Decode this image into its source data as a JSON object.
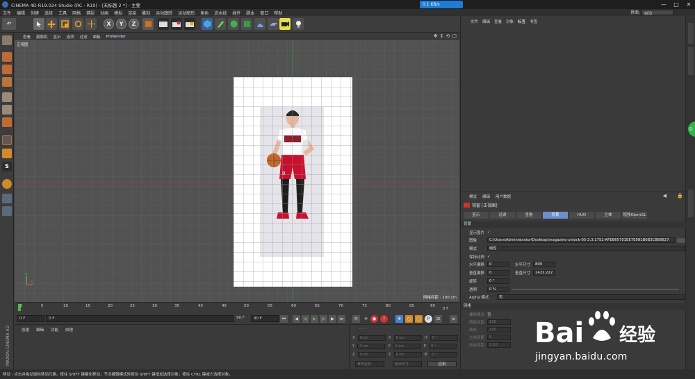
{
  "title_bar": {
    "title": "CINEMA 4D R19.024 Studio (RC - R19) - [未标题 2 *] - 主要",
    "net_badge": "0.1 KB/s",
    "win_min": "—",
    "win_max": "□",
    "win_close": "✕"
  },
  "menu": {
    "items": [
      "文件",
      "编辑",
      "创建",
      "选择",
      "工具",
      "网格",
      "捕捉",
      "动画",
      "模拟",
      "渲染",
      "雕刻",
      "运动跟踪",
      "运动图形",
      "角色",
      "流水线",
      "插件",
      "脚本",
      "窗口",
      "帮助"
    ],
    "layout_label": "界面:",
    "layout_value": "启动"
  },
  "toolbar": {
    "axis_x": "X",
    "axis_y": "Y",
    "axis_z": "Z"
  },
  "viewport_menu": {
    "items": [
      "查看",
      "摄像机",
      "显示",
      "选项",
      "过滤",
      "面板"
    ],
    "prorender": "ProRender"
  },
  "viewport": {
    "label": "正视图",
    "grid_spacing": "网格间距 : 100 cm",
    "axis_y": "Y",
    "axis_x": "X",
    "jersey_number": "9"
  },
  "timeline": {
    "ticks": [
      "0",
      "5",
      "10",
      "15",
      "20",
      "25",
      "30",
      "35",
      "40",
      "45",
      "50",
      "55",
      "60",
      "65",
      "70",
      "75",
      "80",
      "85",
      "90"
    ],
    "end_label": "0 F"
  },
  "transport": {
    "start": "0 F",
    "current": "0 F",
    "end": "90 F",
    "max": "90 F"
  },
  "materials": {
    "tabs": [
      "创建",
      "编辑",
      "功能",
      "纹理"
    ]
  },
  "coords": {
    "header": "- - -",
    "rows": [
      {
        "a": "X",
        "av": "0 cm",
        "b": "X",
        "bv": "0 cm",
        "c": "H",
        "cv": "0 °"
      },
      {
        "a": "Y",
        "av": "0 cm",
        "b": "Y",
        "bv": "0 cm",
        "c": "P",
        "cv": "0 °"
      },
      {
        "a": "Z",
        "av": "0 cm",
        "b": "Z",
        "bv": "0 cm",
        "c": "B",
        "cv": "0 °"
      }
    ],
    "mode1": "世界坐标",
    "mode2": "绝对尺寸",
    "apply": "应用"
  },
  "object_manager": {
    "tabs": [
      "文件",
      "编辑",
      "查看",
      "对象",
      "标签",
      "书签"
    ]
  },
  "attr_manager": {
    "top_tabs": [
      "模式",
      "编辑",
      "用户数据"
    ],
    "title": "视窗 [正视图]",
    "tabs": [
      "显示",
      "过滤",
      "查看",
      "背景",
      "HUD",
      "立体",
      "增强OpenGL"
    ],
    "active_tab": "背景",
    "section_bg": "背景",
    "show_image_label": "显示图片",
    "show_image_value": "✓",
    "image_label": "图像",
    "image_value": "C:\\Users\\Administrator\\Desktop\\magazine-unlock-05-2.3.1752-AFEB65701EE7E981B0B3C888827",
    "mode_label": "模式",
    "mode_value": "线性",
    "keep_ratio_label": "保持比例",
    "keep_ratio_value": "✓",
    "h_offset_label": "水平偏移",
    "h_offset_value": "0",
    "h_size_label": "水平尺寸",
    "h_size_value": "800",
    "v_offset_label": "垂直偏移",
    "v_offset_value": "0",
    "v_size_label": "垂直尺寸",
    "v_size_value": "1422.222",
    "rotate_label": "旋转",
    "rotate_value": "0 °",
    "transparency_label": "透明",
    "transparency_value": "0 %",
    "alpha_label": "Alpha 模式",
    "alpha_value": "无",
    "section_grid": "网格",
    "grid_type_label": "栅格模式",
    "grid_type_value": "否",
    "grid_spacing_label": "网格间距",
    "grid_spacing_value": "100",
    "lines_label": "线条",
    "lines_value": "100",
    "main_lines_label": "主线间距",
    "main_lines_value": "5",
    "dynamic_label": "动态间距",
    "dynamic_value": "1.10"
  },
  "status": "移动 : 点击并拖动鼠标移动元素。按住 SHIFT 键量化移动；节点编辑模式时按住 SHIFT 键增加选择对象；按住 CTRL 键减少选择对象。",
  "watermark": {
    "brand_left": "Bai",
    "brand_right": "经验",
    "url": "jingyan.baidu.com"
  },
  "logo_vertical": "MAXON CINEMA 4D",
  "side_fab": "D"
}
